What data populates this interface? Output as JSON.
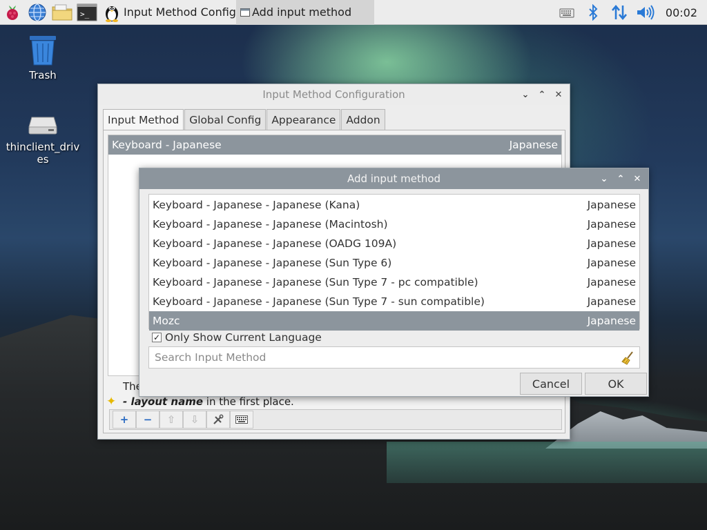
{
  "taskbar": {
    "tasks": [
      {
        "label": "Input Method Configu..."
      },
      {
        "label": "Add input method"
      }
    ],
    "clock": "00:02"
  },
  "desktop": {
    "icons": [
      {
        "label": "Trash"
      },
      {
        "label_line1": "thinclient_driv",
        "label_line2": "es"
      }
    ]
  },
  "config_window": {
    "title": "Input Method Configuration",
    "tabs": [
      "Input Method",
      "Global Config",
      "Appearance",
      "Addon"
    ],
    "active_tab": "Input Method",
    "input_methods": [
      {
        "name": "Keyboard - Japanese",
        "lang": "Japanese",
        "selected": true
      }
    ],
    "hint_prefix": "The",
    "hint_bold": "- layout name",
    "hint_suffix": " in the first place."
  },
  "add_dialog": {
    "title": "Add input method",
    "items": [
      {
        "name": "Keyboard - Japanese - Japanese (Kana)",
        "lang": "Japanese",
        "selected": false
      },
      {
        "name": "Keyboard - Japanese - Japanese (Macintosh)",
        "lang": "Japanese",
        "selected": false
      },
      {
        "name": "Keyboard - Japanese - Japanese (OADG 109A)",
        "lang": "Japanese",
        "selected": false
      },
      {
        "name": "Keyboard - Japanese - Japanese (Sun Type 6)",
        "lang": "Japanese",
        "selected": false
      },
      {
        "name": "Keyboard - Japanese - Japanese (Sun Type 7 - pc compatible)",
        "lang": "Japanese",
        "selected": false
      },
      {
        "name": "Keyboard - Japanese - Japanese (Sun Type 7 - sun compatible)",
        "lang": "Japanese",
        "selected": false
      },
      {
        "name": "Mozc",
        "lang": "Japanese",
        "selected": true
      }
    ],
    "only_current_language_label": "Only Show Current Language",
    "only_current_language_checked": true,
    "search_placeholder": "Search Input Method",
    "search_value": "",
    "cancel_label": "Cancel",
    "ok_label": "OK"
  },
  "colors": {
    "selection": "#8c959d",
    "accent_blue": "#2a6bc2"
  }
}
